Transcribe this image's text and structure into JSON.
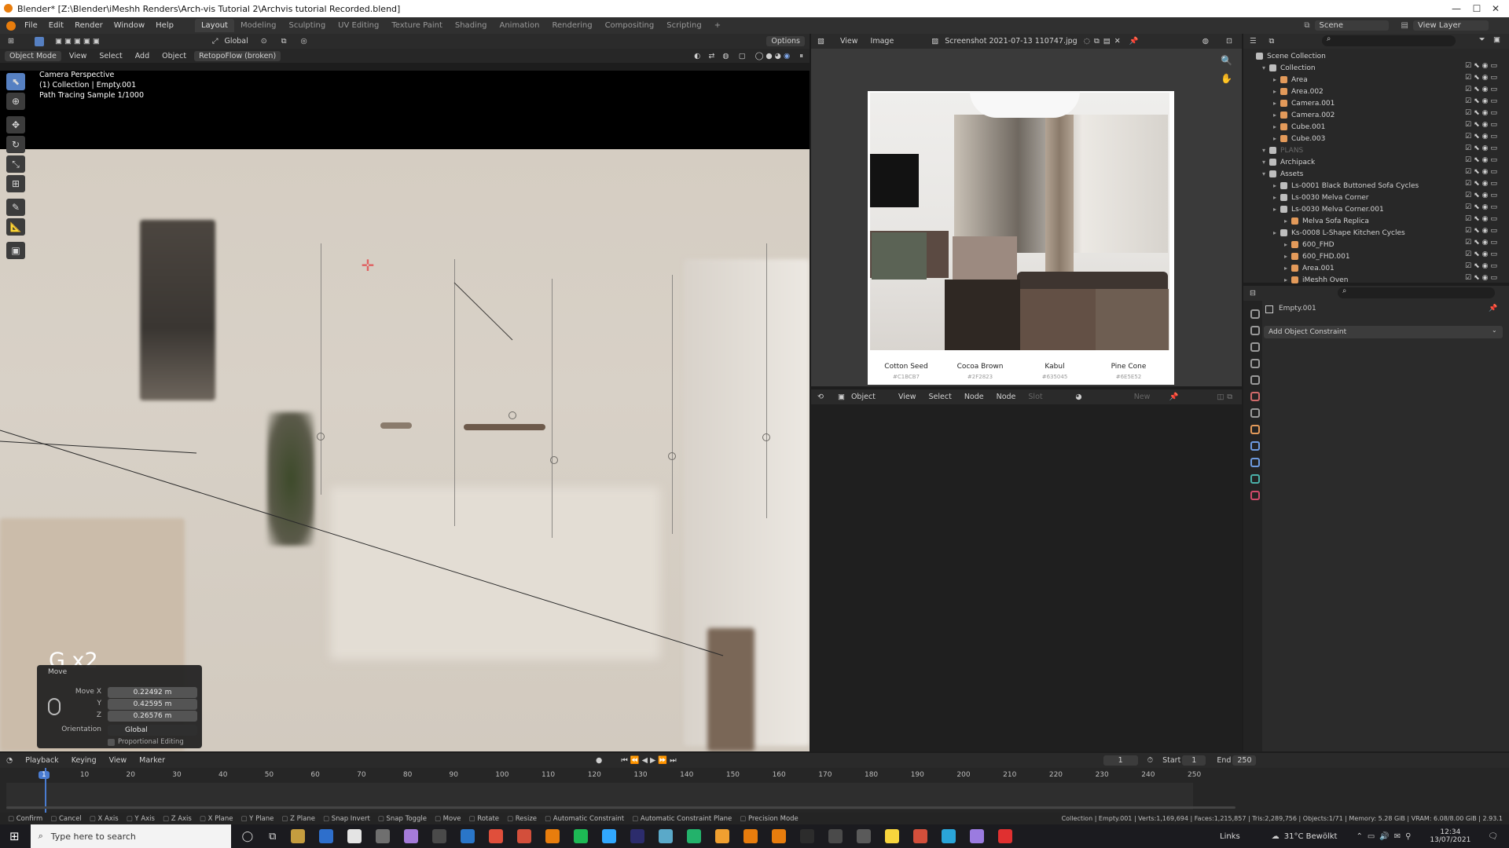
{
  "window": {
    "title": "Blender* [Z:\\Blender\\iMeshh Renders\\Arch-vis Tutorial 2\\Archvis tutorial Recorded.blend]",
    "min": "—",
    "max": "☐",
    "close": "✕"
  },
  "menus": [
    "File",
    "Edit",
    "Render",
    "Window",
    "Help"
  ],
  "workspaces": [
    "Layout",
    "Modeling",
    "Sculpting",
    "UV Editing",
    "Texture Paint",
    "Shading",
    "Animation",
    "Rendering",
    "Compositing",
    "Scripting"
  ],
  "workspace_add": "+",
  "scene": {
    "name": "Scene",
    "view_layer": "View Layer"
  },
  "toolheader": {
    "orientation": "Global",
    "options": "Options"
  },
  "viewport_header": {
    "mode": "Object Mode",
    "view": "View",
    "select": "Select",
    "add": "Add",
    "object": "Object",
    "addon": "RetopoFlow (broken)"
  },
  "viewport_overlay": {
    "line1": "Camera Perspective",
    "line2": "(1) Collection | Empty.001",
    "line3": "Path Tracing Sample 1/1000",
    "keyhint": "G x2"
  },
  "operator": {
    "title": "Move",
    "x_label": "Move X",
    "x": "0.22492 m",
    "y_label": "Y",
    "y": "0.42595 m",
    "z_label": "Z",
    "z": "0.26576 m",
    "orient_label": "Orientation",
    "orient": "Global",
    "prop_edit": "Proportional Editing"
  },
  "image_editor": {
    "view": "View",
    "image": "Image",
    "file": "Screenshot 2021-07-13 110747.jpg"
  },
  "swatches": [
    {
      "name": "Cotton Seed",
      "hex": "#C1BCB7",
      "color": "#c1bcb7"
    },
    {
      "name": "Cocoa Brown",
      "hex": "#2F2823",
      "color": "#2f2823"
    },
    {
      "name": "Kabul",
      "hex": "#635045",
      "color": "#635045"
    },
    {
      "name": "Pine Cone",
      "hex": "#6E5E52",
      "color": "#6e5e52"
    }
  ],
  "swatch_colors": {
    "sage": "#5b6355",
    "taupe": "#9c8a80"
  },
  "node_header": {
    "object": "Object",
    "view": "View",
    "select": "Select",
    "add": "Node",
    "node": "Node",
    "slot": "Slot",
    "new": "New"
  },
  "outliner": {
    "root": "Scene Collection",
    "items": [
      {
        "label": "Collection",
        "level": 0,
        "kind": "coll"
      },
      {
        "label": "Area",
        "level": 1,
        "kind": "light"
      },
      {
        "label": "Area.002",
        "level": 1,
        "kind": "light"
      },
      {
        "label": "Camera.001",
        "level": 1,
        "kind": "cam"
      },
      {
        "label": "Camera.002",
        "level": 1,
        "kind": "cam"
      },
      {
        "label": "Cube.001",
        "level": 1,
        "kind": "mesh"
      },
      {
        "label": "Cube.003",
        "level": 1,
        "kind": "mesh"
      },
      {
        "label": "PLANS",
        "level": 0,
        "kind": "coll"
      },
      {
        "label": "Archipack",
        "level": 0,
        "kind": "coll"
      },
      {
        "label": "Assets",
        "level": 0,
        "kind": "coll"
      },
      {
        "label": "Ls-0001 Black Buttoned Sofa Cycles",
        "level": 1,
        "kind": "coll"
      },
      {
        "label": "Ls-0030 Melva Corner",
        "level": 1,
        "kind": "coll"
      },
      {
        "label": "Ls-0030 Melva Corner.001",
        "level": 1,
        "kind": "coll"
      },
      {
        "label": "Melva Sofa Replica",
        "level": 2,
        "kind": "mesh"
      },
      {
        "label": "Ks-0008 L-Shape Kitchen Cycles",
        "level": 1,
        "kind": "coll"
      },
      {
        "label": "600_FHD",
        "level": 2,
        "kind": "mesh"
      },
      {
        "label": "600_FHD.001",
        "level": 2,
        "kind": "mesh"
      },
      {
        "label": "Area.001",
        "level": 2,
        "kind": "light"
      },
      {
        "label": "iMeshh Oven",
        "level": 2,
        "kind": "mesh"
      }
    ],
    "kind_colors": {
      "coll": "#bdbdbd",
      "light": "#e39a5a",
      "cam": "#e39a5a",
      "mesh": "#e39a5a"
    }
  },
  "properties": {
    "object": "Empty.001",
    "constraint_btn": "Add Object Constraint"
  },
  "timeline_header": {
    "playback": "Playback",
    "keying": "Keying",
    "view": "View",
    "marker": "Marker",
    "frame": "1",
    "start_label": "Start",
    "start": "1",
    "end_label": "End",
    "end": "250"
  },
  "timeline_ticks": [
    "1",
    "10",
    "20",
    "30",
    "40",
    "50",
    "60",
    "70",
    "80",
    "90",
    "100",
    "110",
    "120",
    "130",
    "140",
    "150",
    "160",
    "170",
    "180",
    "190",
    "200",
    "210",
    "220",
    "230",
    "240",
    "250"
  ],
  "statusbar": {
    "keys": [
      "Confirm",
      "Cancel",
      "X Axis",
      "Y Axis",
      "Z Axis",
      "X Plane",
      "Y Plane",
      "Z Plane",
      "Snap Invert",
      "Snap Toggle",
      "Move",
      "Rotate",
      "Resize",
      "Automatic Constraint",
      "Automatic Constraint Plane",
      "Precision Mode"
    ],
    "stats": "Collection | Empty.001 | Verts:1,169,694 | Faces:1,215,857 | Tris:2,289,756 | Objects:1/71 | Memory: 5.28 GiB | VRAM: 6.08/8.00 GiB | 2.93.1"
  },
  "taskbar": {
    "search": "Type here to search",
    "app_colors": [
      "#c59d3f",
      "#2e6fcc",
      "#e4e4e4",
      "#6f6f6f",
      "#a57bd9",
      "#4a4a4a",
      "#2a76c9",
      "#e04f3b",
      "#d34f3b",
      "#e87d0d",
      "#1db954",
      "#31a8ff",
      "#2c2c6c",
      "#5aa9c9",
      "#23b26b",
      "#f0a030",
      "#e87d0d",
      "#e87d0d",
      "#2c2c2c",
      "#4a4a4a",
      "#5a5a5a",
      "#f8d53d",
      "#d34f3b",
      "#2aa5d9",
      "#9b7be0",
      "#e03030"
    ],
    "links": "Links",
    "weather": "31°C  Bewölkt",
    "time": "12:34",
    "date": "13/07/2021"
  }
}
